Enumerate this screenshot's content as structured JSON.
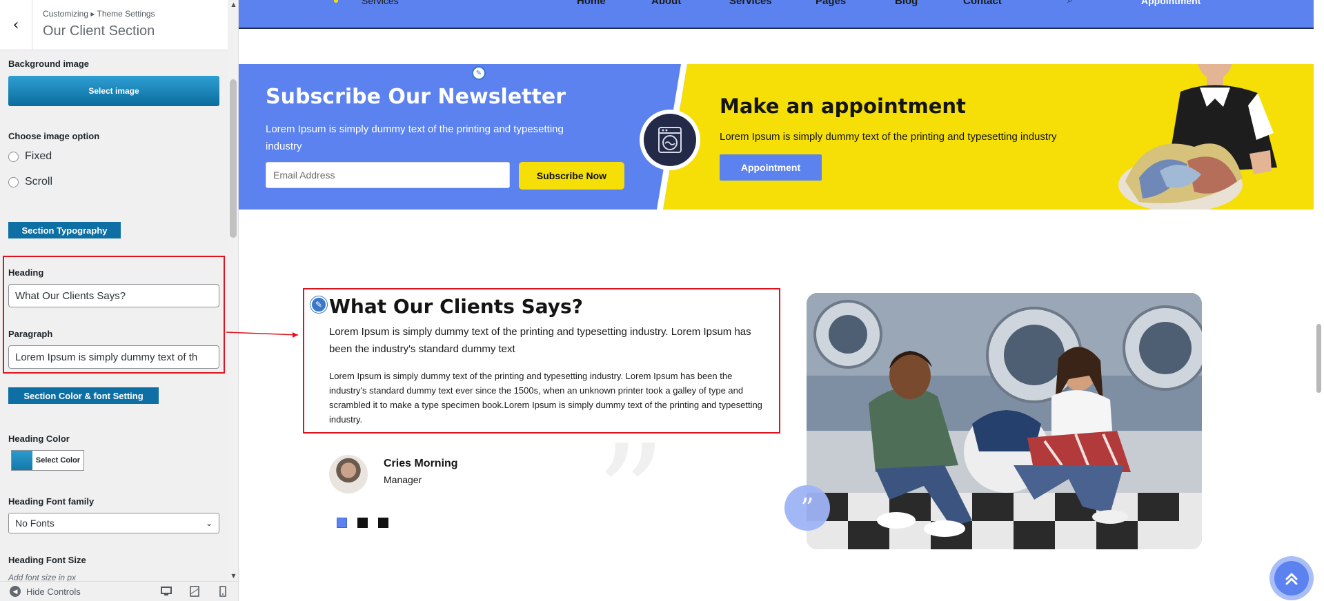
{
  "sidebar": {
    "breadcrumb": "Customizing ▸ Theme Settings",
    "title": "Our Client Section",
    "background_image_label": "Background image",
    "select_image_label": "Select image",
    "image_option_label": "Choose image option",
    "radio_options": [
      "Fixed",
      "Scroll"
    ],
    "section_typography_label": "Section Typography",
    "heading_label": "Heading",
    "heading_value": "What Our Clients Says?",
    "paragraph_label": "Paragraph",
    "paragraph_value": "Lorem Ipsum is simply dummy text of th",
    "section_color_label": "Section Color & font Setting",
    "heading_color_label": "Heading Color",
    "select_color_label": "Select Color",
    "heading_font_family_label": "Heading Font family",
    "font_family_value": "No Fonts",
    "heading_font_size_label": "Heading Font Size",
    "font_size_hint": "Add font size in px",
    "hide_controls_label": "Hide Controls"
  },
  "nav": {
    "logo_sub": "Services",
    "items": [
      "Home",
      "About",
      "Services",
      "Pages",
      "Blog",
      "Contact"
    ],
    "appointment_label": "Appointment"
  },
  "newsletter": {
    "title": "Subscribe Our Newsletter",
    "text": "Lorem Ipsum is simply dummy text of the printing and typesetting industry",
    "email_placeholder": "Email Address",
    "button_label": "Subscribe Now"
  },
  "appointment": {
    "title": "Make an appointment",
    "text": "Lorem Ipsum is simply dummy text of the printing and typesetting industry",
    "button_label": "Appointment"
  },
  "clients": {
    "title": "What Our Clients Says?",
    "lead": "Lorem Ipsum is simply dummy text of the printing and typesetting industry. Lorem Ipsum has been the industry's standard dummy text",
    "body": "Lorem Ipsum is simply dummy text of the printing and typesetting industry. Lorem Ipsum has been the industry's standard dummy text ever since the 1500s, when an unknown printer took a galley of type and scrambled it to make a type specimen book.Lorem Ipsum is simply dummy text of the printing and typesetting industry.",
    "name": "Cries Morning",
    "role": "Manager",
    "slider_dots": 3,
    "active_dot": 0
  },
  "colors": {
    "brand_blue": "#5b82ef",
    "brand_yellow": "#f5df07",
    "wp_blue": "#0d6fa4",
    "highlight_red": "#e0131d"
  },
  "icons": [
    "back-chevron-icon",
    "pencil-icon",
    "washing-machine-icon",
    "search-icon",
    "quote-icon",
    "chevron-up-icon",
    "desktop-icon",
    "tablet-icon",
    "mobile-icon",
    "hide-controls-icon",
    "dropdown-chevron-icon"
  ]
}
